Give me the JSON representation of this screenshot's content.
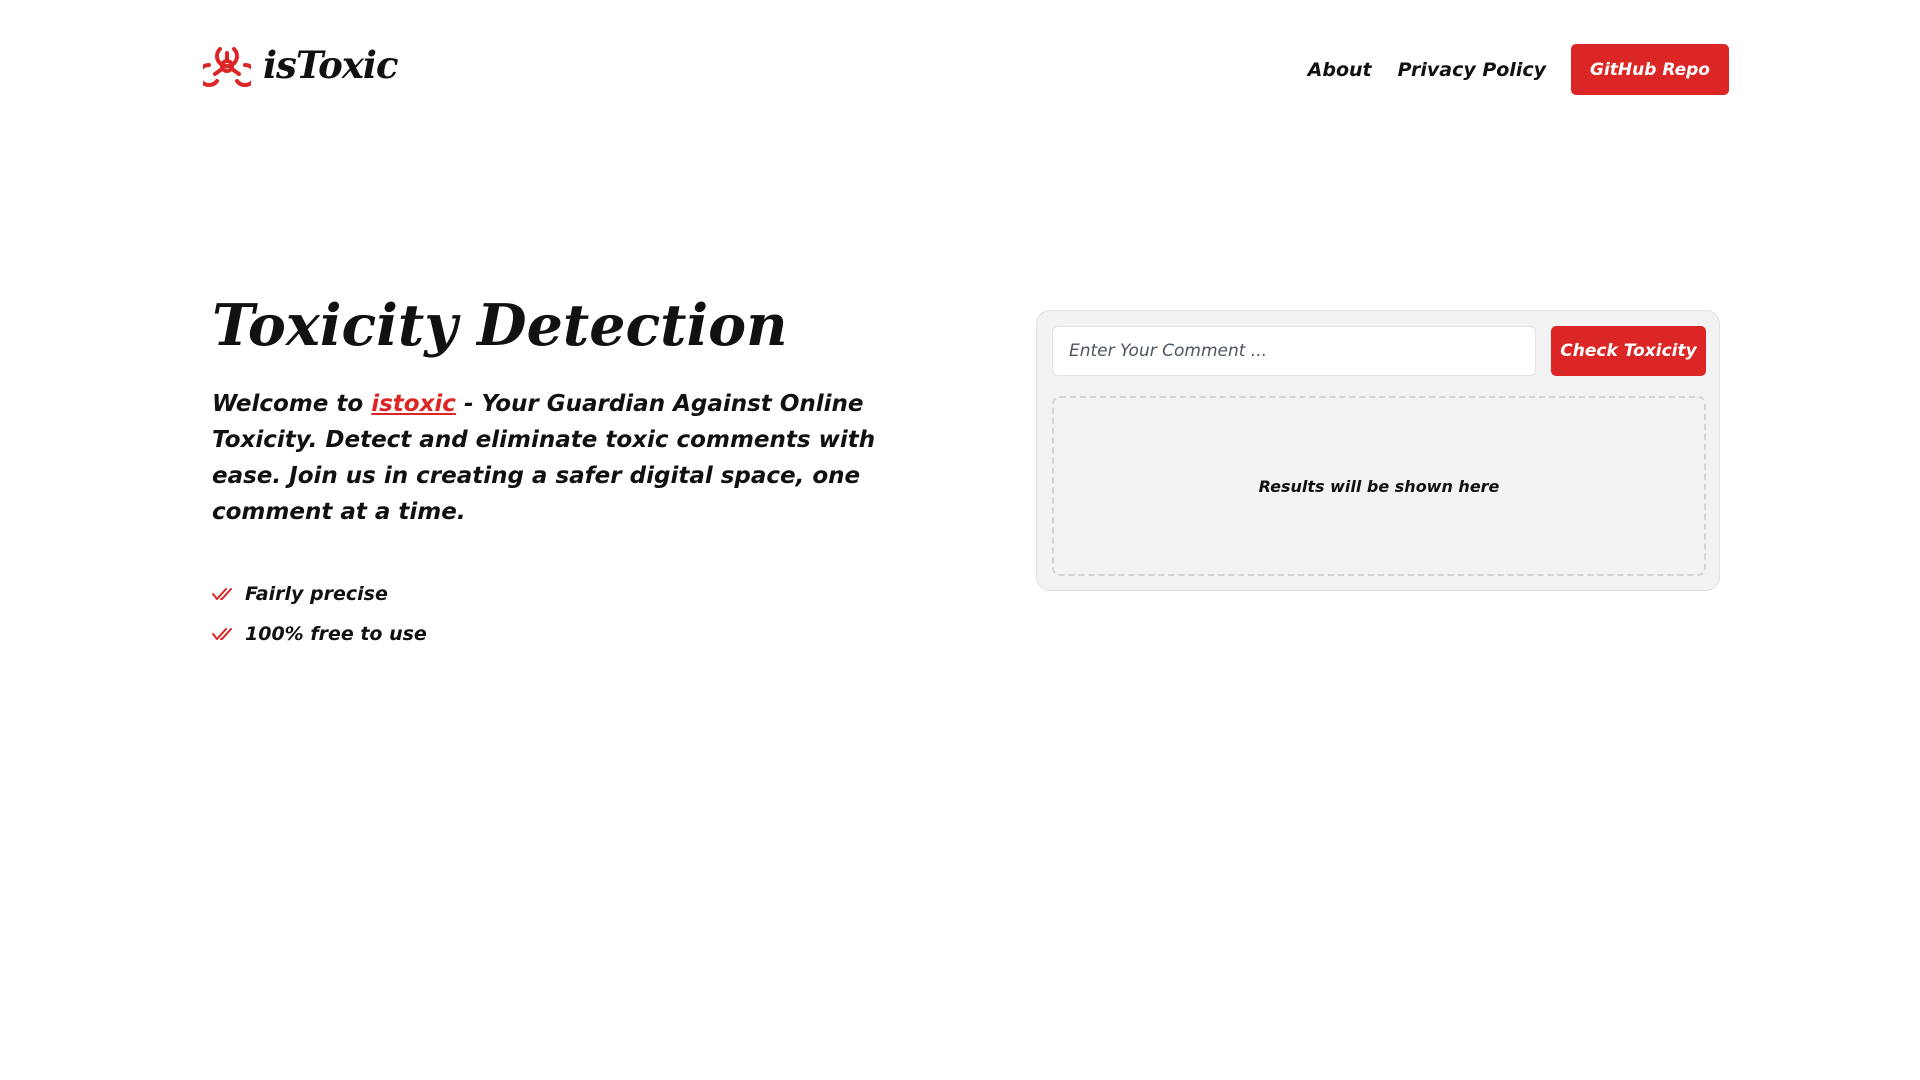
{
  "header": {
    "brand": {
      "icon": "biohazard-icon",
      "name": "isToxic"
    },
    "nav": [
      {
        "label": "About"
      },
      {
        "label": "Privacy Policy"
      }
    ],
    "cta_label": "GitHub Repo"
  },
  "hero": {
    "title": "Toxicity Detection",
    "intro_prefix": "Welcome to ",
    "brand_link": "istoxic",
    "intro_suffix": " - Your Guardian Against Online Toxicity. Detect and eliminate toxic comments with ease. Join us in creating a safer digital space, one comment at a time.",
    "features": [
      {
        "icon": "double-check-icon",
        "label": "Fairly precise"
      },
      {
        "icon": "double-check-icon",
        "label": "100% free to use"
      }
    ]
  },
  "checker": {
    "input_placeholder": "Enter Your Comment ...",
    "input_value": "",
    "button_label": "Check Toxicity",
    "results_placeholder": "Results will be shown here"
  },
  "colors": {
    "accent": "#dc2626",
    "panel_bg": "#f3f3f3",
    "text": "#111111"
  }
}
